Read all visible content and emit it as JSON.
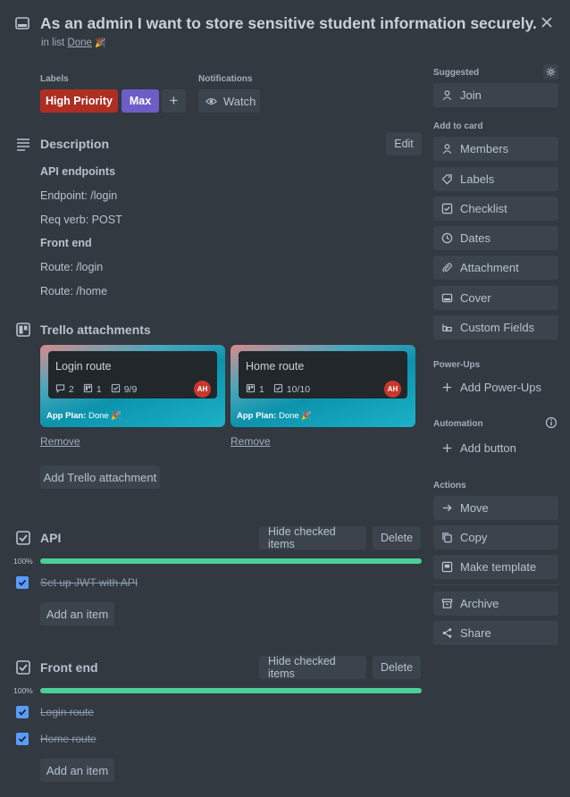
{
  "card": {
    "title": "As an admin I want to store sensitive student information securely.",
    "in_list_prefix": "in list",
    "list_name": "Done",
    "list_emoji": "🎉"
  },
  "labels": {
    "heading": "Labels",
    "items": [
      {
        "text": "High Priority",
        "color": "#ae2e24"
      },
      {
        "text": "Max",
        "color": "#6e5dc6"
      }
    ],
    "add": "+"
  },
  "notifications": {
    "heading": "Notifications",
    "watch": "Watch"
  },
  "description": {
    "heading": "Description",
    "edit": "Edit",
    "lines": [
      "API endpoints",
      "Endpoint: /login",
      "Req verb: POST",
      "Front end",
      "Route: /login",
      "Route: /home"
    ]
  },
  "attachments": {
    "heading": "Trello attachments",
    "cards": [
      {
        "title": "Login route",
        "comments": "2",
        "attachments": "1",
        "checklist": "9/9",
        "avatar": "AH",
        "plan_label": "App Plan:",
        "plan_value": "Done 🎉",
        "remove": "Remove"
      },
      {
        "title": "Home route",
        "attachments": "1",
        "checklist": "10/10",
        "avatar": "AH",
        "plan_label": "App Plan:",
        "plan_value": "Done 🎉",
        "remove": "Remove"
      }
    ],
    "add": "Add Trello attachment"
  },
  "checklists": [
    {
      "title": "API",
      "hide": "Hide checked items",
      "delete": "Delete",
      "percent": "100%",
      "progress": 1.0,
      "items": [
        "Set up JWT with API"
      ],
      "add": "Add an item"
    },
    {
      "title": "Front end",
      "hide": "Hide checked items",
      "delete": "Delete",
      "percent": "100%",
      "progress": 1.0,
      "items": [
        "Login route",
        "Home route"
      ],
      "add": "Add an item"
    }
  ],
  "sidebar": {
    "suggested": "Suggested",
    "join": "Join",
    "add_to_card": "Add to card",
    "members": "Members",
    "labels": "Labels",
    "checklist": "Checklist",
    "dates": "Dates",
    "attachment": "Attachment",
    "cover": "Cover",
    "custom_fields": "Custom Fields",
    "power_ups": "Power-Ups",
    "add_power_ups": "Add Power-Ups",
    "automation": "Automation",
    "add_button": "Add button",
    "actions": "Actions",
    "move": "Move",
    "copy": "Copy",
    "make_template": "Make template",
    "archive": "Archive",
    "share": "Share"
  }
}
